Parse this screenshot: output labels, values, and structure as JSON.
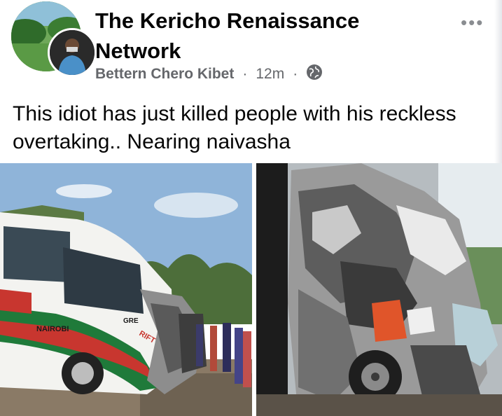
{
  "post": {
    "group_name": "The Kericho Renaissance Network",
    "author": "Bettern Chero Kibet",
    "time": "12m",
    "separator": "·",
    "more_icon": "•••",
    "text": "This idiot has just killed people with his reckless overtaking.. Nearing naivasha"
  },
  "photos": [
    {
      "vehicle_texts": [
        "NAIROBI",
        "RIFT",
        "GRE"
      ]
    },
    {
      "vehicle_texts": []
    }
  ],
  "icons": {
    "privacy": "globe-icon",
    "more": "more-options-icon"
  }
}
